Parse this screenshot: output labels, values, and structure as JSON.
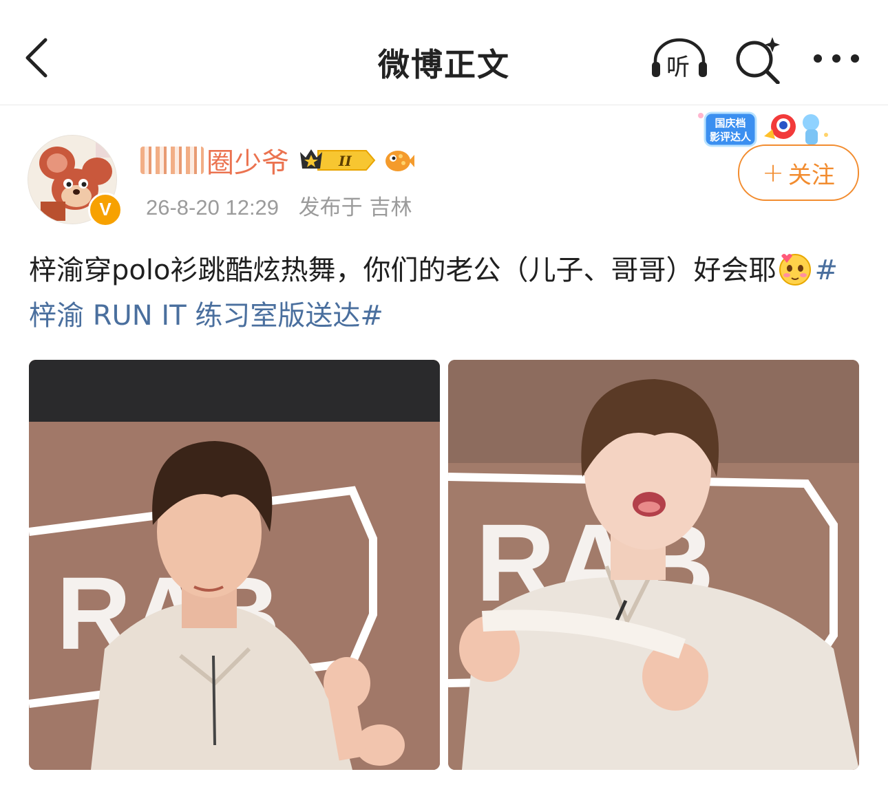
{
  "navbar": {
    "title": "微博正文",
    "back_icon": "chevron-left-icon",
    "listen_label": "听",
    "search_icon": "search-sparkle-icon",
    "more_icon": "more-dots-icon"
  },
  "post": {
    "author": {
      "username": "圈少爷",
      "verified": true,
      "verify_mark": "V",
      "vip_level": "II",
      "avatar_icon": "cartoon-mouse-avatar"
    },
    "timestamp": "26-8-20 12:29",
    "location": "发布于 吉林",
    "event_badge": "国庆档 影评达人",
    "follow_button": {
      "plus": "+",
      "label": "关注"
    },
    "text_main": "梓渝穿polo衫跳酷炫热舞，你们的老公（儿子、哥哥）好会耶",
    "hashtag": "#梓渝 RUN IT 练习室版送达#",
    "images": [
      {
        "description": "dancer-photo-left",
        "sign": "RAB"
      },
      {
        "description": "dancer-photo-right",
        "sign": "RAB"
      }
    ]
  },
  "colors": {
    "username": "#eb7350",
    "hashtag": "#4a6f9e",
    "follow": "#f28c2f",
    "verify": "#f7a100"
  }
}
